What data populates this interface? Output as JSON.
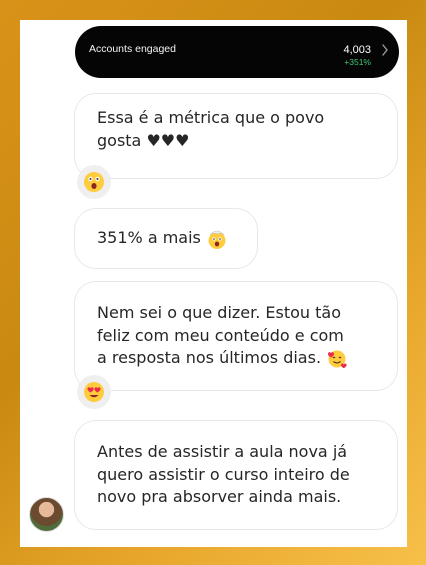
{
  "stats": {
    "label": "Accounts engaged",
    "value": "4,003",
    "delta": "+351%"
  },
  "messages": [
    {
      "lines": [
        "Essa é a métrica que o povo",
        "gosta ♥♥♥"
      ],
      "reaction": "shocked-face-icon"
    },
    {
      "lines": [
        "351% a mais"
      ],
      "emoji": "mind-blown-face-icon"
    },
    {
      "lines": [
        "Nem sei o que dizer. Estou tão",
        "feliz com meu conteúdo e com",
        "a resposta nos últimos dias."
      ],
      "emoji": "smiling-face-with-hearts-icon",
      "reaction": "heart-eyes-face-icon"
    },
    {
      "lines": [
        "Antes de assistir a aula nova já",
        "quero assistir o curso inteiro de",
        "novo pra absorver ainda mais."
      ]
    }
  ],
  "colors": {
    "background_gold": "#d99219",
    "card_black": "#050505",
    "delta_green": "#42c978",
    "bubble_border": "#e8e8e8",
    "text": "#262626"
  }
}
